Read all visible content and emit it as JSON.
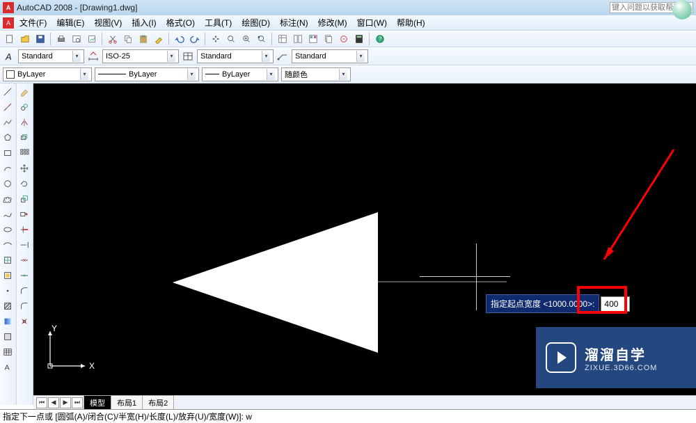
{
  "title": "AutoCAD 2008 - [Drawing1.dwg]",
  "help_placeholder": "键入问题以获取帮助",
  "menu": {
    "file": "文件(F)",
    "edit": "编辑(E)",
    "view": "视图(V)",
    "insert": "插入(I)",
    "format": "格式(O)",
    "tools": "工具(T)",
    "draw": "绘图(D)",
    "dimension": "标注(N)",
    "modify": "修改(M)",
    "window": "窗口(W)",
    "help": "帮助(H)"
  },
  "styles": {
    "text_style": "Standard",
    "dim_style": "ISO-25",
    "table_style": "Standard",
    "mleader_style": "Standard"
  },
  "layer": {
    "current": "ByLayer",
    "linetype": "ByLayer",
    "lineweight": "ByLayer",
    "color": "随颜色"
  },
  "tabs": {
    "model": "模型",
    "layout1": "布局1",
    "layout2": "布局2"
  },
  "ucs": {
    "x": "X",
    "y": "Y"
  },
  "dyn": {
    "prompt": "指定起点宽度 <1000.0000>:",
    "value": "400"
  },
  "cmd": "指定下一点或 [圆弧(A)/闭合(C)/半宽(H)/长度(L)/放弃(U)/宽度(W)]: w",
  "brand": {
    "name": "溜溜自学",
    "url": "ZIXUE.3D66.COM"
  }
}
